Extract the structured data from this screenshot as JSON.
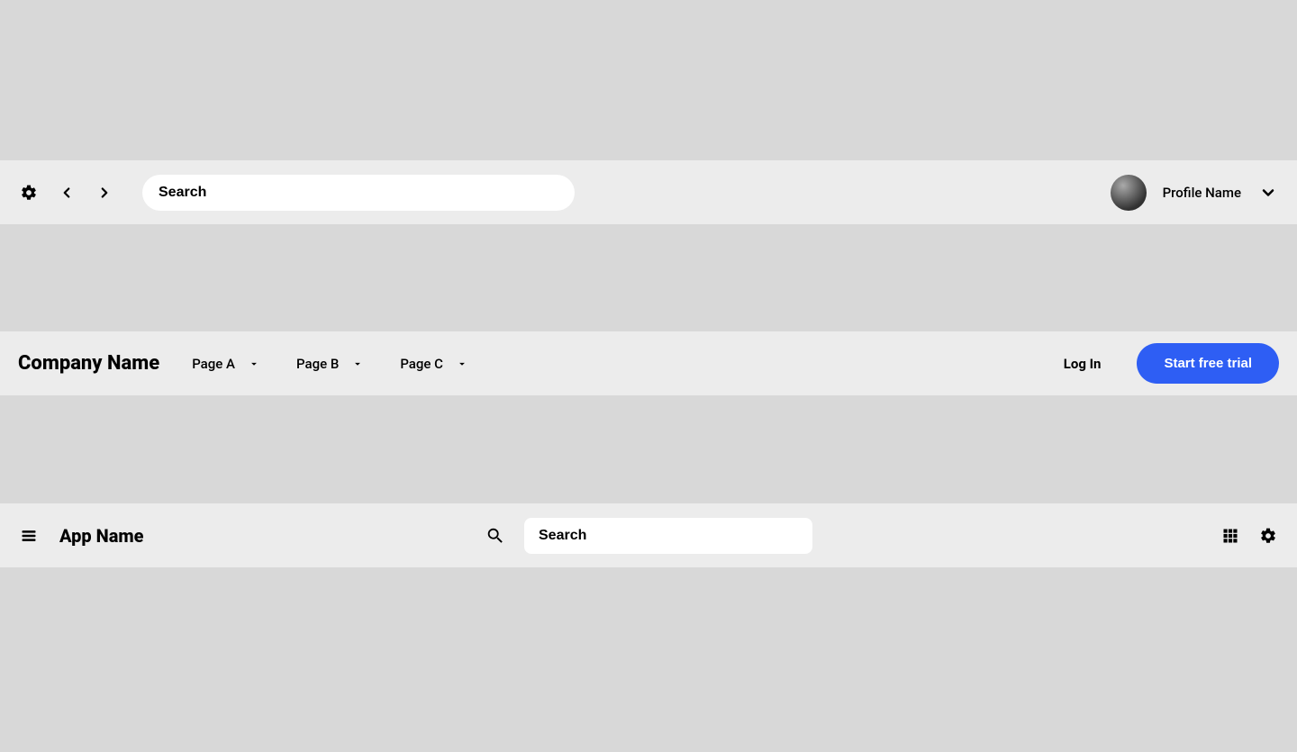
{
  "navbar1": {
    "search_placeholder": "Search",
    "profile_name": "Profile Name"
  },
  "navbar2": {
    "company": "Company Name",
    "pages": [
      {
        "label": "Page A"
      },
      {
        "label": "Page B"
      },
      {
        "label": "Page C"
      }
    ],
    "login_label": "Log In",
    "cta_label": "Start free trial",
    "cta_color": "#2e5ef4"
  },
  "navbar3": {
    "app_name": "App Name",
    "search_placeholder": "Search"
  }
}
